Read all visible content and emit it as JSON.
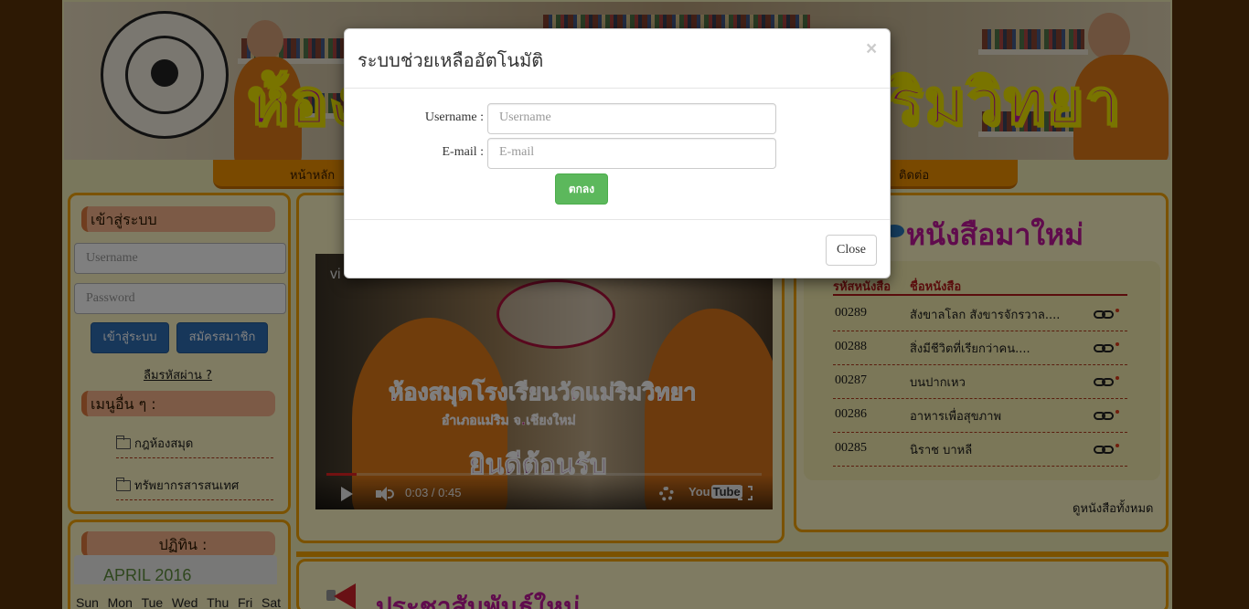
{
  "banner": {
    "title_left": "ห้อง",
    "title_right": "ริมวิทยา"
  },
  "nav": {
    "home": "หน้าหลัก",
    "contact": "ติดต่อ"
  },
  "login_box": {
    "heading": "เข้าสู่ระบบ",
    "username_placeholder": "Username",
    "password_placeholder": "Password",
    "login_button": "เข้าสู่ระบบ",
    "register_button": "สมัครสมาชิก",
    "forgot_link": "ลืมรหัสผ่าน ?"
  },
  "other_menu": {
    "heading": "เมนูอื่น ๆ :",
    "items": [
      {
        "label": "กฎห้องสมุด"
      },
      {
        "label": "ทรัพยากรสารสนเทศ"
      }
    ]
  },
  "calendar": {
    "heading": "ปฏิทิน :",
    "month": "APRIL 2016",
    "weekdays": [
      "Sun",
      "Mon",
      "Tue",
      "Wed",
      "Thu",
      "Fri",
      "Sat"
    ]
  },
  "video": {
    "title_partial": "vi",
    "overlay_line1": "ห้องสมุดโรงเรียนวัดแม่ริมวิทยา",
    "overlay_line2": "อำเภอแม่ริม   จ.เชียงใหม่",
    "overlay_line3": "ยินดีต้อนรับ",
    "time": "0:03 / 0:45",
    "progress": 0.07,
    "brand": "You",
    "brand_box": "Tube"
  },
  "new_books": {
    "heading": "หนังสือมาใหม่",
    "col_code": "รหัสหนังสือ",
    "col_name": "ชื่อหนังสือ",
    "rows": [
      {
        "code": "00289",
        "name": "สังขาลโลก สังขารจักรวาล...."
      },
      {
        "code": "00288",
        "name": "สิ่งมีชีวิตที่เรียกว่าคน...."
      },
      {
        "code": "00287",
        "name": "บนปากเหว"
      },
      {
        "code": "00286",
        "name": "อาหารเพื่อสุขภาพ"
      },
      {
        "code": "00285",
        "name": "นิราช บาหลี"
      }
    ],
    "see_all": "ดูหนังสือทั้งหมด"
  },
  "announcements": {
    "heading": "ประชาสัมพันธ์ใหม่"
  },
  "modal": {
    "title": "ระบบช่วยเหลืออัตโนมัติ",
    "close_x": "×",
    "username_label": "Username :",
    "username_placeholder": "Username",
    "email_label": "E-mail :",
    "email_placeholder": "E-mail",
    "ok_button": "ตกลง",
    "close_button": "Close"
  }
}
